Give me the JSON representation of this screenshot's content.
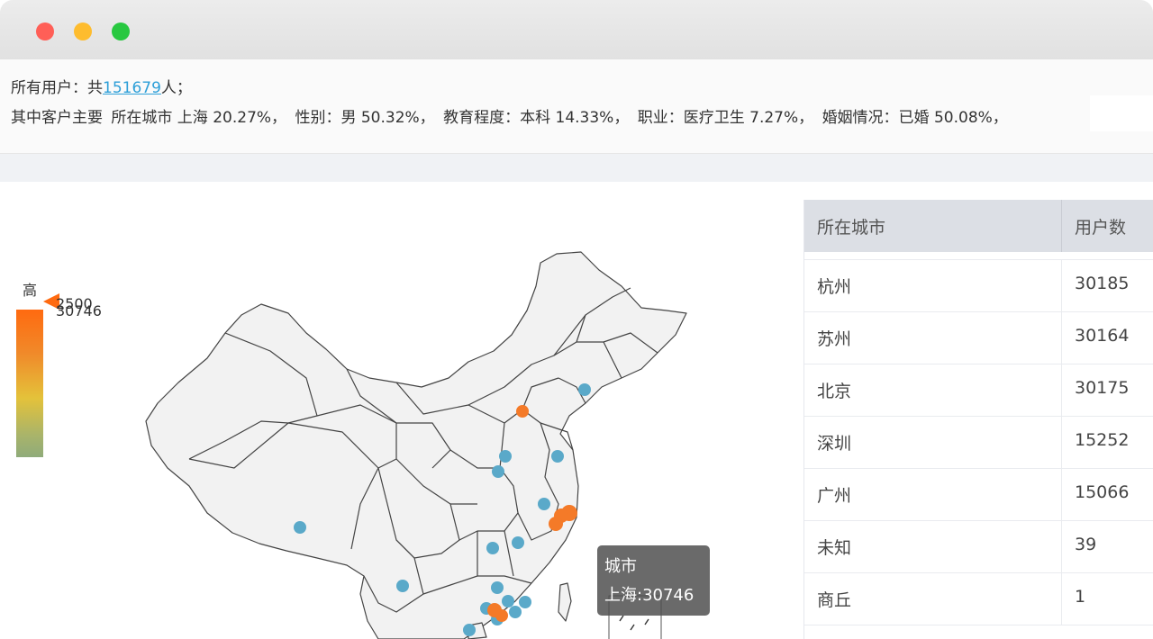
{
  "window": {
    "controls": [
      "close",
      "minimize",
      "maximize"
    ]
  },
  "summary": {
    "line1_prefix": "所有用户：共",
    "total_users": "151679",
    "line1_suffix": "人；",
    "line2_intro": "其中客户主要",
    "segments": [
      "所在城市 上海 20.27%，",
      "性别：男 50.32%，",
      "教育程度：本科 14.33%，",
      "职业：医疗卫生 7.27%，",
      "婚姻情况：已婚 50.08%，"
    ]
  },
  "visual_map": {
    "high_label": "高",
    "max_value": "30746",
    "current_value": "2500",
    "colors": [
      "#ff6a10",
      "#e4c23a",
      "#8fab7a"
    ]
  },
  "map": {
    "region": "china",
    "point_colors": {
      "low": "#5aa9c9",
      "high": "#f47a28"
    },
    "cities": [
      {
        "name": "上海",
        "value": 30746
      },
      {
        "name": "杭州",
        "value": 30185
      },
      {
        "name": "苏州",
        "value": 30164
      },
      {
        "name": "北京",
        "value": 30175
      },
      {
        "name": "深圳",
        "value": 15252
      },
      {
        "name": "广州",
        "value": 15066
      }
    ]
  },
  "tooltip": {
    "title": "城市",
    "content": "上海:30746"
  },
  "table": {
    "columns": [
      "所在城市",
      "用户数"
    ],
    "rows": [
      [
        "杭州",
        "30185"
      ],
      [
        "苏州",
        "30164"
      ],
      [
        "北京",
        "30175"
      ],
      [
        "深圳",
        "15252"
      ],
      [
        "广州",
        "15066"
      ],
      [
        "未知",
        "39"
      ],
      [
        "商丘",
        "1"
      ]
    ]
  }
}
